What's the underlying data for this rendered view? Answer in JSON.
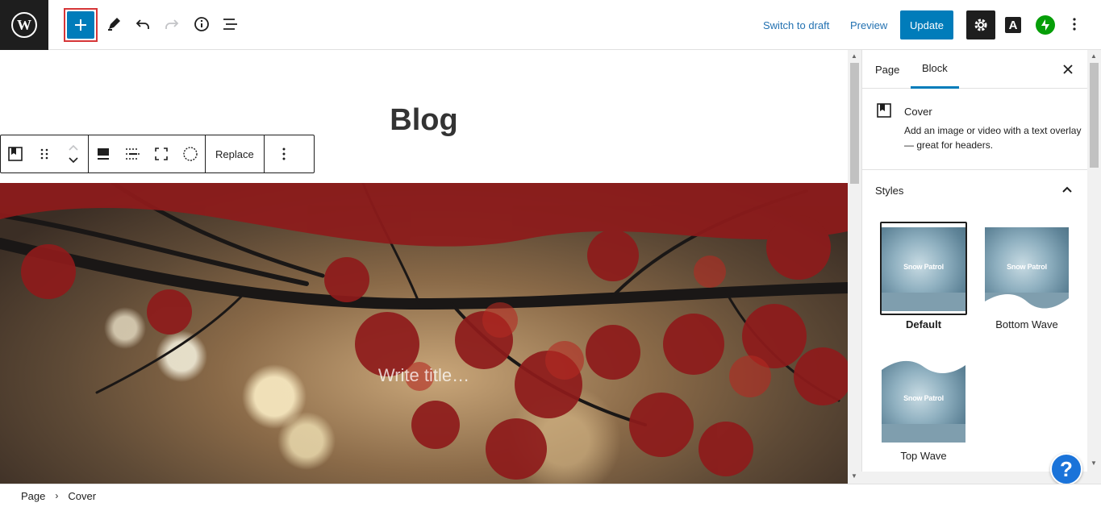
{
  "header": {
    "switch_to_draft": "Switch to draft",
    "preview": "Preview",
    "update": "Update",
    "a_letter": "A"
  },
  "canvas": {
    "page_title": "Blog",
    "cover_placeholder": "Write title…",
    "block_toolbar": {
      "replace_label": "Replace"
    }
  },
  "sidebar": {
    "tabs": [
      {
        "label": "Page"
      },
      {
        "label": "Block"
      }
    ],
    "active_tab": "Block",
    "block_card": {
      "title": "Cover",
      "description": "Add an image or video with a text overlay — great for headers."
    },
    "styles": {
      "title": "Styles",
      "items": [
        {
          "label": "Default",
          "selected": true,
          "thumb_text": "Snow Patrol"
        },
        {
          "label": "Bottom Wave",
          "selected": false,
          "thumb_text": "Snow Patrol"
        },
        {
          "label": "Top Wave",
          "selected": false,
          "thumb_text": "Snow Patrol"
        }
      ]
    },
    "help_label": "?"
  },
  "breadcrumb": {
    "items": [
      "Page",
      "Cover"
    ]
  },
  "colors": {
    "accent": "#007cba",
    "highlight_border": "#d63638",
    "jetpack": "#069e08"
  }
}
